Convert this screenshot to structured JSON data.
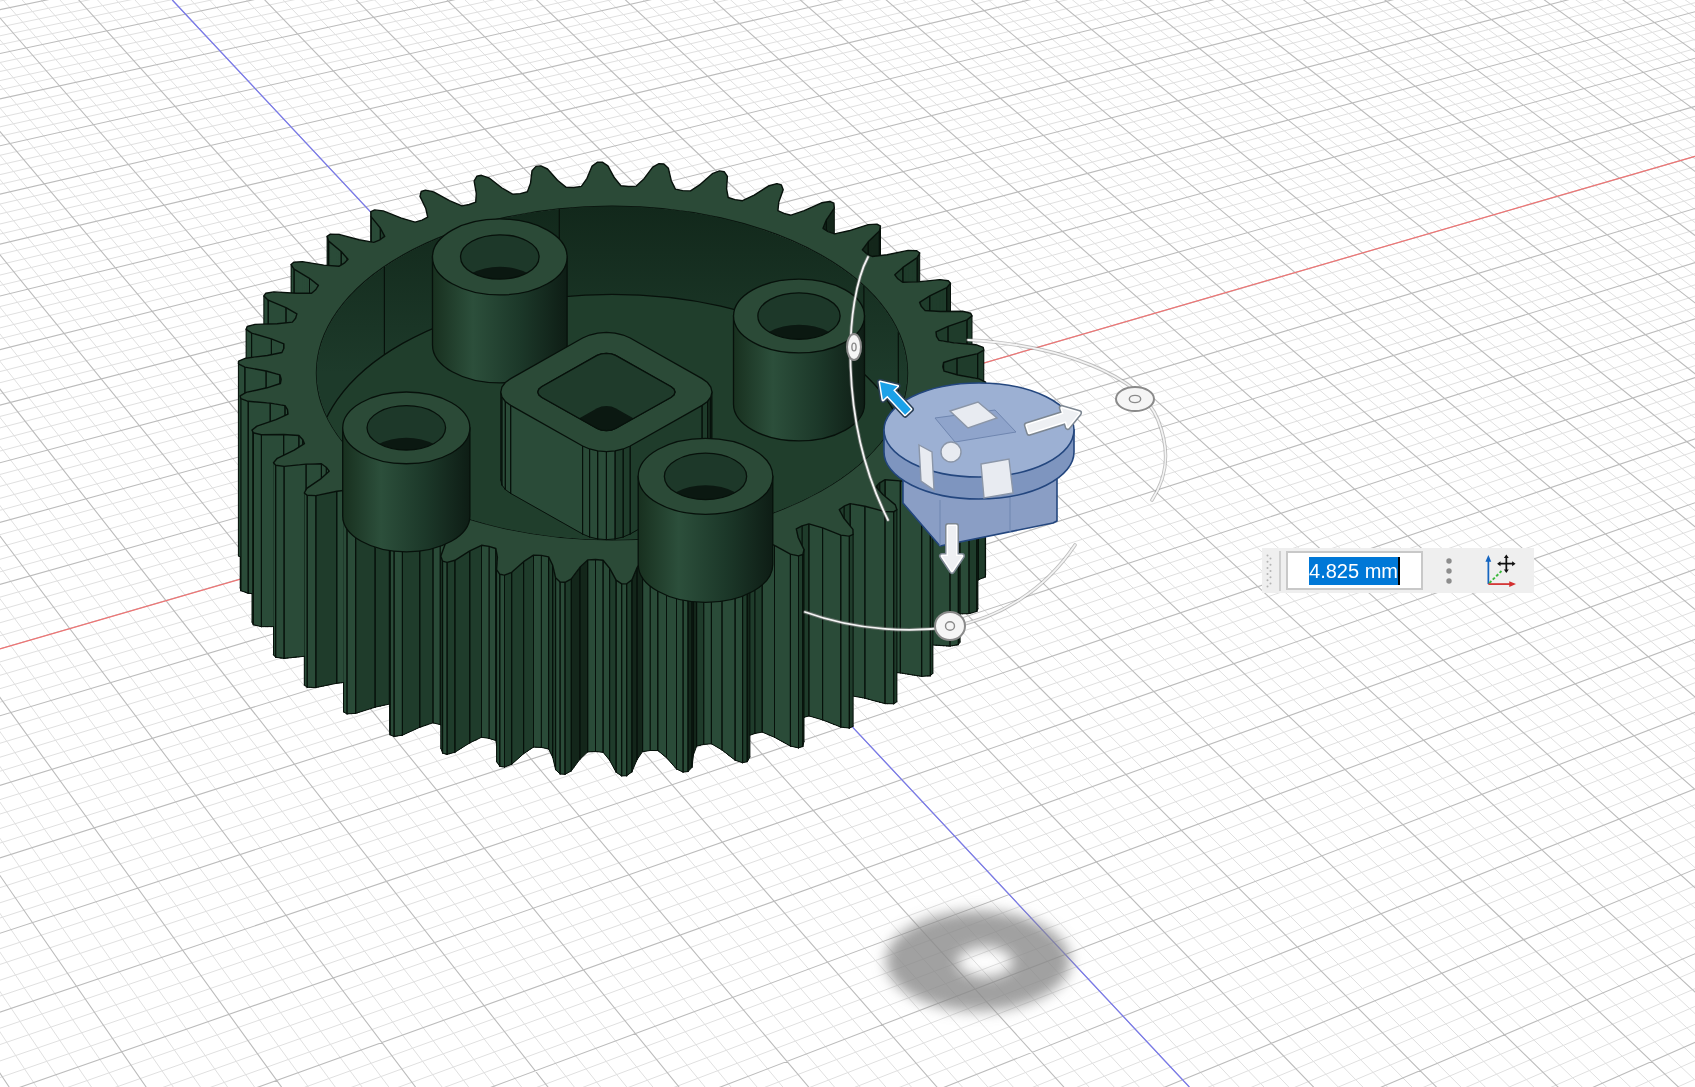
{
  "move_arrows": [
    {
      "selected": true
    },
    {
      "selected": false
    },
    {
      "selected": false
    }
  ],
  "dimension_input": {
    "value": "4.825 mm",
    "text_selected": true
  }
}
